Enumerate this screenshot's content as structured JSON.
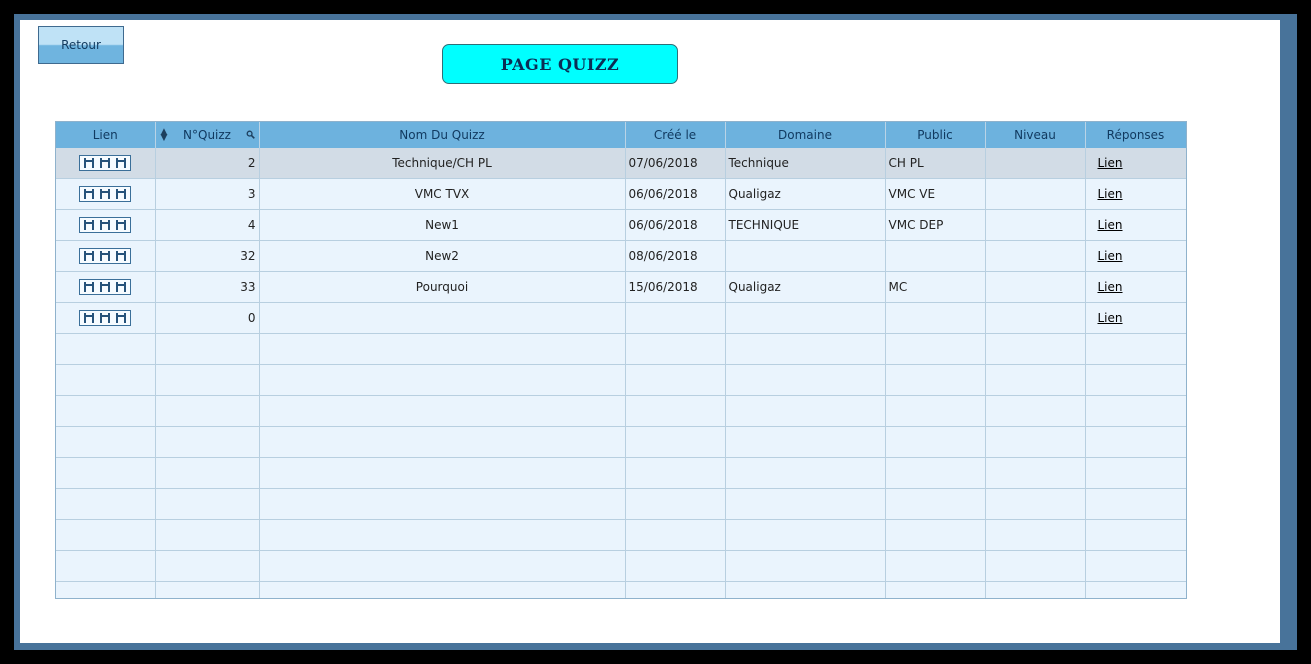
{
  "header": {
    "back_label": "Retour",
    "title": "PAGE QUIZZ"
  },
  "table": {
    "columns": {
      "lien": "Lien",
      "numero": "N°Quizz",
      "nom": "Nom Du Quizz",
      "cree": "Créé le",
      "domaine": "Domaine",
      "public": "Public",
      "niveau": "Niveau",
      "reponses": "Réponses"
    },
    "rows": [
      {
        "numero": "2",
        "nom": "Technique/CH PL",
        "cree": "07/06/2018",
        "domaine": "Technique",
        "public": "CH PL",
        "niveau": "",
        "reponses": "Lien"
      },
      {
        "numero": "3",
        "nom": "VMC TVX",
        "cree": "06/06/2018",
        "domaine": "Qualigaz",
        "public": "VMC VE",
        "niveau": "",
        "reponses": "Lien"
      },
      {
        "numero": "4",
        "nom": "New1",
        "cree": "06/06/2018",
        "domaine": "TECHNIQUE",
        "public": "VMC DEP",
        "niveau": "",
        "reponses": "Lien"
      },
      {
        "numero": "32",
        "nom": "New2",
        "cree": "08/06/2018",
        "domaine": "",
        "public": "",
        "niveau": "",
        "reponses": "Lien"
      },
      {
        "numero": "33",
        "nom": "Pourquoi",
        "cree": "15/06/2018",
        "domaine": "Qualigaz",
        "public": "MC",
        "niveau": "",
        "reponses": "Lien"
      },
      {
        "numero": "0",
        "nom": "",
        "cree": "",
        "domaine": "",
        "public": "",
        "niveau": "",
        "reponses": "Lien"
      }
    ]
  },
  "icons": {
    "lien": "edit-link-icon",
    "sort": "sort-icon",
    "search": "search-icon"
  },
  "colors": {
    "frame": "#48739a",
    "title_bg": "#00ffff",
    "header_bg": "#6db2de",
    "row_bg": "#eaf4fd",
    "selected_row_bg": "#d2dce6"
  }
}
